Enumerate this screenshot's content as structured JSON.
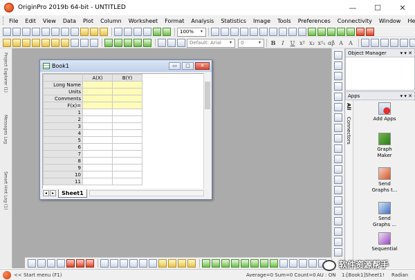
{
  "window": {
    "title": "OriginPro 2019b 64-bit - UNTITLED",
    "controls": {
      "minimize": "—",
      "maximize": "☐",
      "close": "✕"
    }
  },
  "menu": [
    "File",
    "Edit",
    "View",
    "Data",
    "Plot",
    "Column",
    "Worksheet",
    "Format",
    "Analysis",
    "Statistics",
    "Image",
    "Tools",
    "Preferences",
    "Connectivity",
    "Window",
    "Help"
  ],
  "toolbar": {
    "zoom_value": "100%",
    "font_name": "Default: Arial",
    "font_size": "0",
    "format_buttons": [
      "B",
      "I",
      "U",
      "x²",
      "x₂",
      "x²₁",
      "αβ",
      "A",
      "A"
    ]
  },
  "left_panel_tabs": [
    "Project Explorer (1)",
    "Messages Log",
    "Smart Hint Log (1)"
  ],
  "workbook": {
    "title": "Book1",
    "title_controls": [
      "▭",
      "□",
      "✕"
    ],
    "columns": [
      "A(X)",
      "B(Y)"
    ],
    "meta_rows": [
      "Long Name",
      "Units",
      "Comments",
      "F(x)="
    ],
    "row_numbers": [
      "1",
      "2",
      "3",
      "4",
      "5",
      "6",
      "7",
      "8",
      "9",
      "10",
      "11"
    ],
    "sheet_tab": "Sheet1",
    "nav_prev": "◂",
    "nav_next": "▸"
  },
  "object_manager": {
    "title": "Object Manager",
    "controls": "▾ ▾ ✕"
  },
  "apps_panel": {
    "title": "Apps",
    "controls": "▾ ▾ ✕",
    "tabs": [
      "All",
      "Connectors"
    ],
    "items": [
      {
        "label": "Add Apps",
        "icon": "add-apps-icon"
      },
      {
        "label": "Graph Maker",
        "icon": "graph-maker-icon"
      },
      {
        "label": "Send Graphs t...",
        "icon": "send-graphs-ppt-icon"
      },
      {
        "label": "Send Graphs ...",
        "icon": "send-graphs-word-icon"
      },
      {
        "label": "Sequential",
        "icon": "sequential-icon"
      }
    ]
  },
  "statusbar": {
    "start_menu": "<< Start menu (F1)",
    "stats": "Average=0 Sum=0 Count=0",
    "au": "AU : ON",
    "location": "1:[Book1]Sheet1!",
    "angle": "Radian"
  },
  "watermark": "软件资源帮手",
  "colors": {
    "workspace_bg": "#ababab",
    "meta_cell_bg": "#fffbb8",
    "title_bg": "#ffffff",
    "book_title_bg": "#c9d8ee",
    "accent_orange": "#e0521c"
  }
}
